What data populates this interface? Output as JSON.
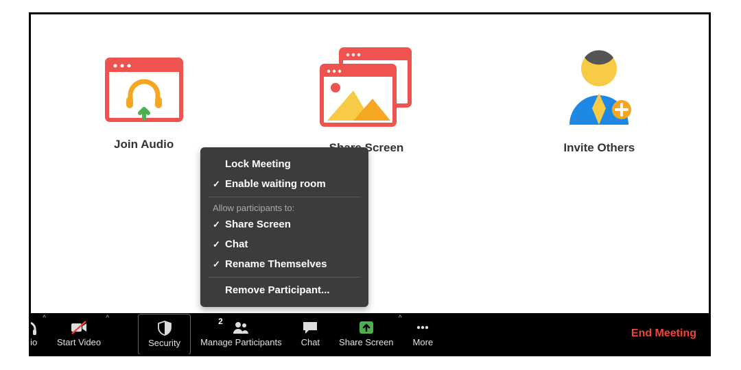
{
  "tiles": {
    "join_audio_label": "Join Audio",
    "share_screen_label": "Share Screen",
    "invite_others_label": "Invite Others"
  },
  "security_menu": {
    "lock_meeting": "Lock Meeting",
    "enable_waiting_room": "Enable waiting room",
    "allow_header": "Allow participants to:",
    "allow_share": "Share Screen",
    "allow_chat": "Chat",
    "allow_rename": "Rename Themselves",
    "remove_participant": "Remove Participant..."
  },
  "toolbar": {
    "audio_label": "udio",
    "start_video_label": "Start Video",
    "security_label": "Security",
    "manage_participants_label": "Manage Participants",
    "participant_count": "2",
    "chat_label": "Chat",
    "share_screen_label": "Share Screen",
    "more_label": "More",
    "end_meeting_label": "End Meeting"
  },
  "state": {
    "waiting_room_checked": true,
    "share_checked": true,
    "chat_checked": true,
    "rename_checked": true
  },
  "colors": {
    "accent_red": "#ef5350",
    "accent_orange": "#f5a623",
    "accent_yellow": "#f8cb46",
    "accent_green": "#4caf50",
    "accent_blue": "#1e88e5",
    "danger": "#f44336"
  }
}
